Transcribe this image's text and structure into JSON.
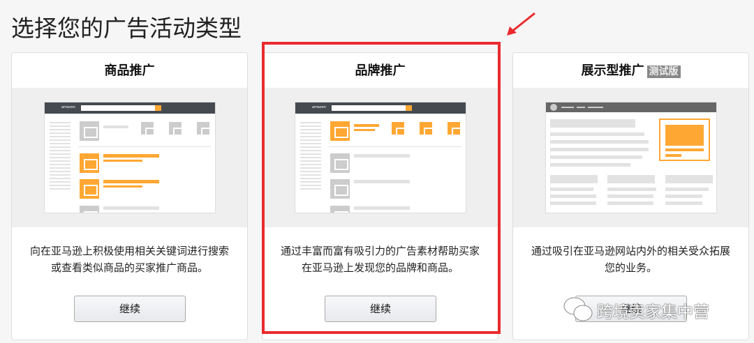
{
  "page_title": "选择您的广告活动类型",
  "cards": [
    {
      "title": "商品推广",
      "description": "向在亚马逊上积极使用相关关键词进行搜索或查看类似商品的买家推广商品。",
      "button": "继续",
      "logo": "amazon"
    },
    {
      "title": "品牌推广",
      "description": "通过丰富而富有吸引力的广告素材帮助买家在亚马逊上发现您的品牌和商品。",
      "button": "继续",
      "logo": "amazon"
    },
    {
      "title": "展示型推广",
      "badge": "测试版",
      "description": "通过吸引在亚马逊网站内外的相关受众拓展您的业务。",
      "button": "继续"
    }
  ],
  "watermark": "跨境卖家集中营",
  "colors": {
    "accent": "#ffa733",
    "highlight": "#ea2a2e"
  }
}
